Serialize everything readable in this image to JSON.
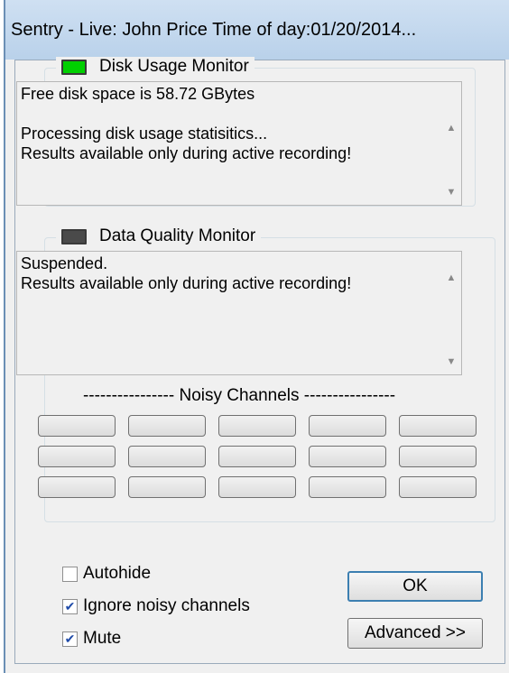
{
  "window": {
    "title": "Sentry - Live:   John Price   Time of day:01/20/2014..."
  },
  "disk_usage": {
    "legend": "Disk Usage Monitor",
    "indicator_color": "#00d000",
    "lines": [
      "Free disk space is 58.72 GBytes",
      "",
      "Processing disk usage statisitics...",
      "Results available only during active recording!"
    ]
  },
  "data_quality": {
    "legend": "Data Quality Monitor",
    "indicator_color": "#4a4a4a",
    "lines": [
      "Suspended.",
      "Results available only during active recording!"
    ],
    "noisy_channels_label": "---------------- Noisy Channels ----------------",
    "channel_rows": 3,
    "channel_cols": 5
  },
  "options": {
    "autohide": {
      "label": "Autohide",
      "checked": false
    },
    "ignore_noisy": {
      "label": "Ignore noisy channels",
      "checked": true
    },
    "mute": {
      "label": "Mute",
      "checked": true
    }
  },
  "buttons": {
    "ok": "OK",
    "advanced": "Advanced >>"
  },
  "icons": {
    "scroll_up": "scroll-up-arrow-icon",
    "scroll_down": "scroll-down-arrow-icon",
    "check": "checkmark-icon"
  }
}
